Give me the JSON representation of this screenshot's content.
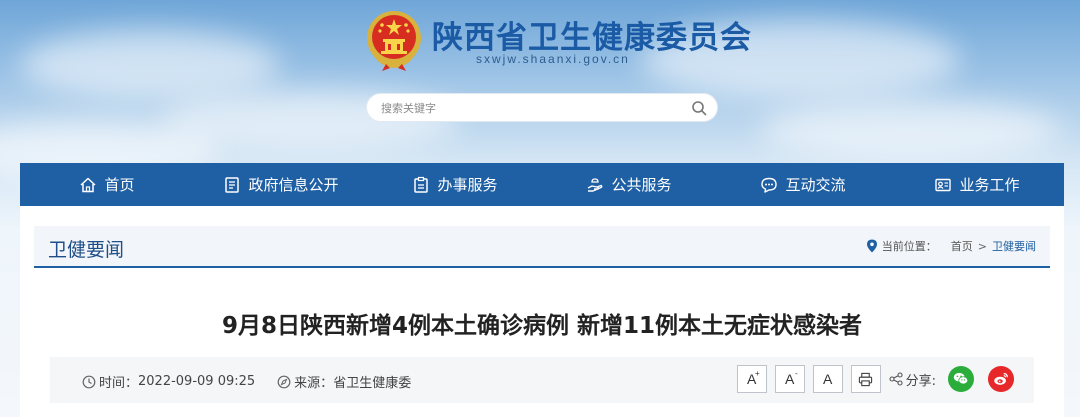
{
  "header": {
    "site_title": "陕西省卫生健康委员会",
    "site_domain": "sxwjw.shaanxi.gov.cn",
    "search_placeholder": "搜索关键字"
  },
  "nav": {
    "items": [
      {
        "label": "首页",
        "icon": "home-icon"
      },
      {
        "label": "政府信息公开",
        "icon": "document-icon"
      },
      {
        "label": "办事服务",
        "icon": "clipboard-icon"
      },
      {
        "label": "公共服务",
        "icon": "hand-service-icon"
      },
      {
        "label": "互动交流",
        "icon": "chat-icon"
      },
      {
        "label": "业务工作",
        "icon": "id-card-icon"
      }
    ]
  },
  "section": {
    "title": "卫健要闻",
    "breadcrumb_label": "当前位置：",
    "breadcrumb_home": "首页",
    "breadcrumb_sep": ">",
    "breadcrumb_current": "卫健要闻"
  },
  "article": {
    "title": "9月8日陕西新增4例本土确诊病例 新增11例本土无症状感染者",
    "time_label": "时间：",
    "time_value": "2022-09-09 09:25",
    "source_label": "来源：",
    "source_value": "省卫生健康委"
  },
  "tools": {
    "font_large": "A",
    "font_large_sup": "+",
    "font_small": "A",
    "font_small_sup": "-",
    "font_reset": "A",
    "share_label": "分享:"
  },
  "colors": {
    "nav_bg": "#1f5fa4",
    "title_blue": "#1b5ba6",
    "wechat_green": "#2bad3b",
    "weibo_red": "#e6282a"
  }
}
